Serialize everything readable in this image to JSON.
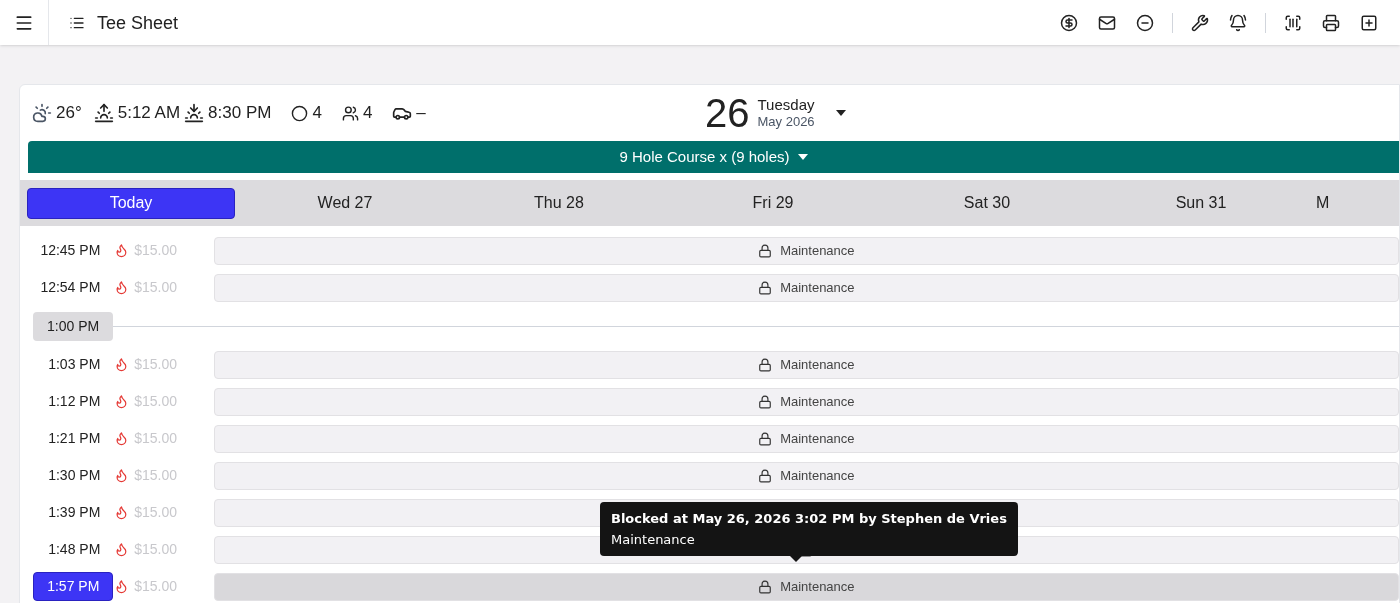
{
  "header": {
    "title": "Tee Sheet"
  },
  "weather": {
    "temperature": "26°",
    "sunrise": "5:12 AM",
    "sunset": "8:30 PM",
    "rounds": "4",
    "players": "4",
    "carts": "–"
  },
  "date": {
    "day": "26",
    "weekday": "Tuesday",
    "month_year": "May 2026"
  },
  "course": {
    "label": "9 Hole Course x (9 holes)"
  },
  "days": [
    {
      "label": "Today",
      "selected": true
    },
    {
      "label": "Wed 27",
      "selected": false
    },
    {
      "label": "Thu 28",
      "selected": false
    },
    {
      "label": "Fri 29",
      "selected": false
    },
    {
      "label": "Sat 30",
      "selected": false
    },
    {
      "label": "Sun 31",
      "selected": false
    },
    {
      "label": "M",
      "selected": false
    }
  ],
  "rows": [
    {
      "kind": "slot",
      "time": "12:45 PM",
      "price": "$15.00",
      "label": "Maintenance",
      "selected": false
    },
    {
      "kind": "slot",
      "time": "12:54 PM",
      "price": "$15.00",
      "label": "Maintenance",
      "selected": false
    },
    {
      "kind": "separator",
      "time": "1:00 PM"
    },
    {
      "kind": "slot",
      "time": "1:03 PM",
      "price": "$15.00",
      "label": "Maintenance",
      "selected": false
    },
    {
      "kind": "slot",
      "time": "1:12 PM",
      "price": "$15.00",
      "label": "Maintenance",
      "selected": false
    },
    {
      "kind": "slot",
      "time": "1:21 PM",
      "price": "$15.00",
      "label": "Maintenance",
      "selected": false
    },
    {
      "kind": "slot",
      "time": "1:30 PM",
      "price": "$15.00",
      "label": "Maintenance",
      "selected": false
    },
    {
      "kind": "slot",
      "time": "1:39 PM",
      "price": "$15.00",
      "selected": false
    },
    {
      "kind": "slot",
      "time": "1:48 PM",
      "price": "$15.00",
      "selected": false
    },
    {
      "kind": "slot",
      "time": "1:57 PM",
      "price": "$15.00",
      "label": "Maintenance",
      "selected": true
    }
  ],
  "tooltip": {
    "title": "Blocked at May 26, 2026 3:02 PM by Stephen de Vries",
    "text": "Maintenance"
  }
}
